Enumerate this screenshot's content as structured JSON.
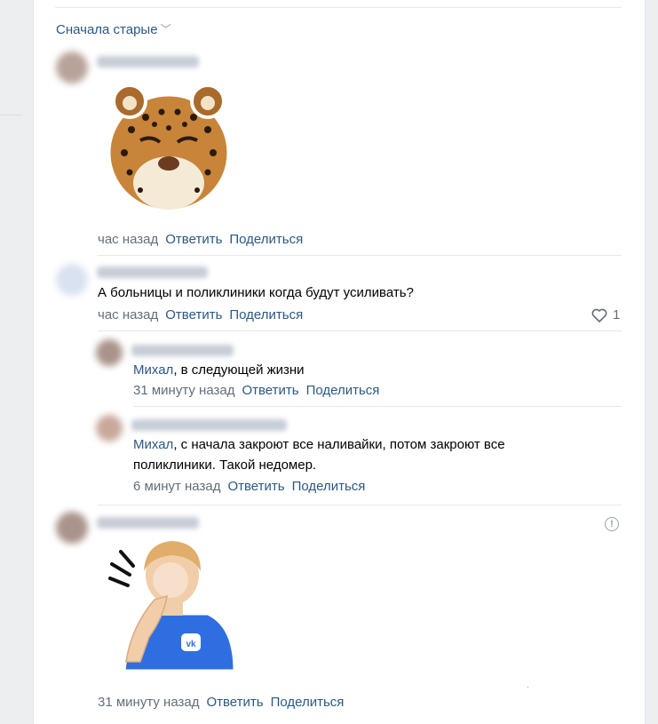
{
  "sort": {
    "label": "Сначала старые"
  },
  "comments": [
    {
      "id": "c1",
      "time": "час назад",
      "reply": "Ответить",
      "share": "Поделиться",
      "sticker": "leopard-sticker"
    },
    {
      "id": "c2",
      "text": "А больницы и поликлиники когда будут усиливать?",
      "time": "час назад",
      "reply": "Ответить",
      "share": "Поделиться",
      "likes": "1"
    },
    {
      "id": "c3",
      "mention": "Михал",
      "text": ", в следующей жизни",
      "time": "31 минуту назад",
      "reply": "Ответить",
      "share": "Поделиться"
    },
    {
      "id": "c4",
      "mention": "Михал",
      "text": ", с начала закроют все наливайки, потом закроют все поликлиники. Такой недомер.",
      "time": "6 минут назад",
      "reply": "Ответить",
      "share": "Поделиться"
    },
    {
      "id": "c5",
      "time": "31 минуту назад",
      "reply": "Ответить",
      "share": "Поделиться",
      "sticker": "facepalm-vk-sticker"
    }
  ],
  "icons": {
    "like": "heart-icon",
    "report": "exclamation-circle-icon",
    "sort": "chevron-down-icon"
  },
  "colors": {
    "link": "#2a5885",
    "meta": "#626d7a",
    "divider": "#e7e8ec",
    "vk_blue": "#2f6ee0"
  }
}
